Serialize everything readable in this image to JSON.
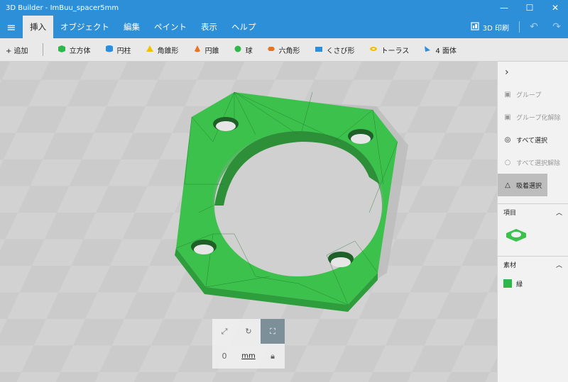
{
  "window": {
    "title": "3D Builder - ImBuu_spacer5mm",
    "minimize": "—",
    "maximize": "☐",
    "close": "✕"
  },
  "ribbon": {
    "tabs": [
      "挿入",
      "オブジェクト",
      "編集",
      "ペイント",
      "表示",
      "ヘルプ"
    ],
    "active_tab": 0,
    "print_label": "3D 印刷"
  },
  "toolbar": {
    "add_label": "+ 追加",
    "shapes": [
      {
        "label": "立方体",
        "icon": "cube-icon",
        "color": "#2fb84a"
      },
      {
        "label": "円柱",
        "icon": "cylinder-icon",
        "color": "#2b8fe0"
      },
      {
        "label": "角錐形",
        "icon": "pyramid-icon",
        "color": "#f2c200"
      },
      {
        "label": "円錐",
        "icon": "cone-icon",
        "color": "#e8741f"
      },
      {
        "label": "球",
        "icon": "sphere-icon",
        "color": "#2fb84a"
      },
      {
        "label": "六角形",
        "icon": "hexagon-icon",
        "color": "#e8741f"
      },
      {
        "label": "くさび形",
        "icon": "wedge-icon",
        "color": "#2b8fe0"
      },
      {
        "label": "トーラス",
        "icon": "torus-icon",
        "color": "#f2c200"
      },
      {
        "label": "4 面体",
        "icon": "tetrahedron-icon",
        "color": "#2b8fe0"
      }
    ]
  },
  "viewport": {
    "measurement_text": "0 m"
  },
  "sidepanel": {
    "actions": [
      {
        "label": "グループ",
        "icon": "group-icon",
        "disabled": true
      },
      {
        "label": "グループ化解除",
        "icon": "ungroup-icon",
        "disabled": true
      },
      {
        "label": "すべて選択",
        "icon": "select-all-icon",
        "disabled": false
      },
      {
        "label": "すべて選択解除",
        "icon": "deselect-all-icon",
        "disabled": true
      },
      {
        "label": "吸着選択",
        "icon": "lasso-select-icon",
        "disabled": false,
        "active": true
      }
    ],
    "items_header": "項目",
    "material_header": "素材",
    "material_name": "緑",
    "material_color": "#2fb84a"
  },
  "floatbox": {
    "value": "0",
    "unit": "mm"
  }
}
